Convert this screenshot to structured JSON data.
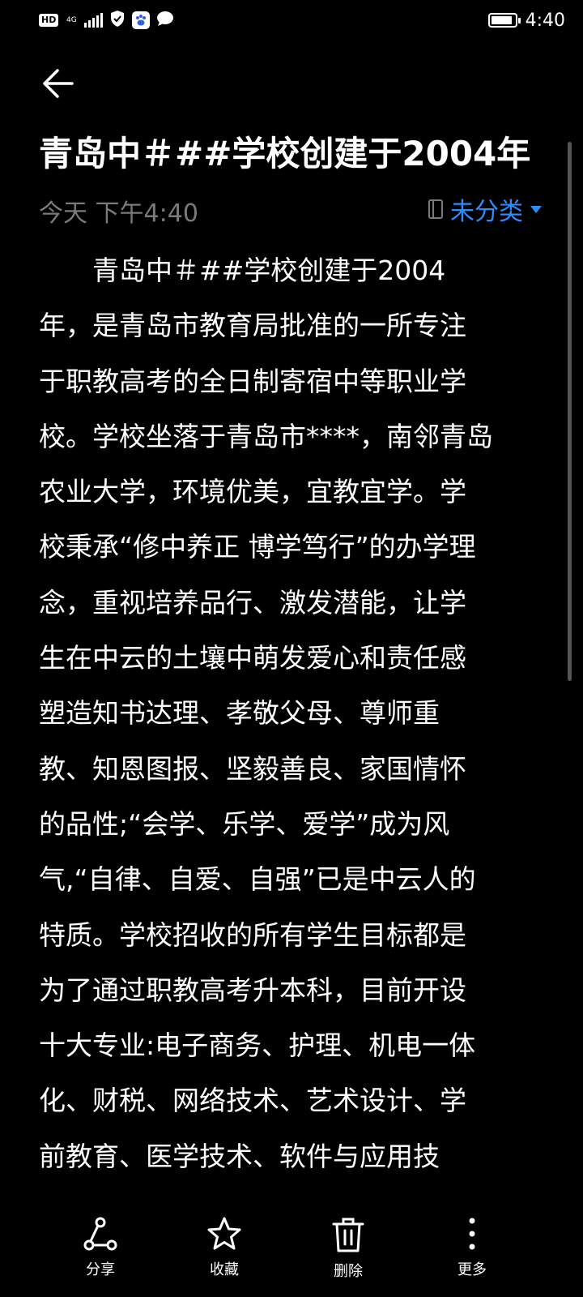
{
  "status_bar": {
    "hd": "HD",
    "network": "4G",
    "time": "4:40",
    "battery_level": 0.9
  },
  "note": {
    "title": "青岛中＃##学校创建于2004年",
    "date": "今天 下午4:40",
    "category": "未分类",
    "accent_color": "#2f8cff",
    "body_lines": [
      "　　青岛中＃##学校创建于2004",
      "年，是青岛市教育局批准的一所专注",
      "于职教高考的全日制寄宿中等职业学",
      "校。学校坐落于青岛市****，南邻青岛",
      "农业大学，环境优美，宜教宜学。学",
      "校秉承“修中养正 博学笃行”的办学理",
      "念，重视培养品行、激发潜能，让学",
      "生在中云的土壤中萌发爱心和责任感",
      "塑造知书达理、孝敬父母、尊师重",
      "教、知恩图报、坚毅善良、家国情怀",
      "的品性;“会学、乐学、爱学”成为风",
      "气,“自律、自爱、自强”已是中云人的",
      "特质。学校招收的所有学生目标都是",
      "为了通过职教高考升本科，目前开设",
      "十大专业:电子商务、护理、机电一体",
      "化、财税、网络技术、艺术设计、学",
      "前教育、医学技术、软件与应用技"
    ]
  },
  "actions": [
    {
      "label": "分享",
      "icon": "share-icon"
    },
    {
      "label": "收藏",
      "icon": "star-icon"
    },
    {
      "label": "删除",
      "icon": "trash-icon"
    },
    {
      "label": "更多",
      "icon": "more-icon"
    }
  ]
}
